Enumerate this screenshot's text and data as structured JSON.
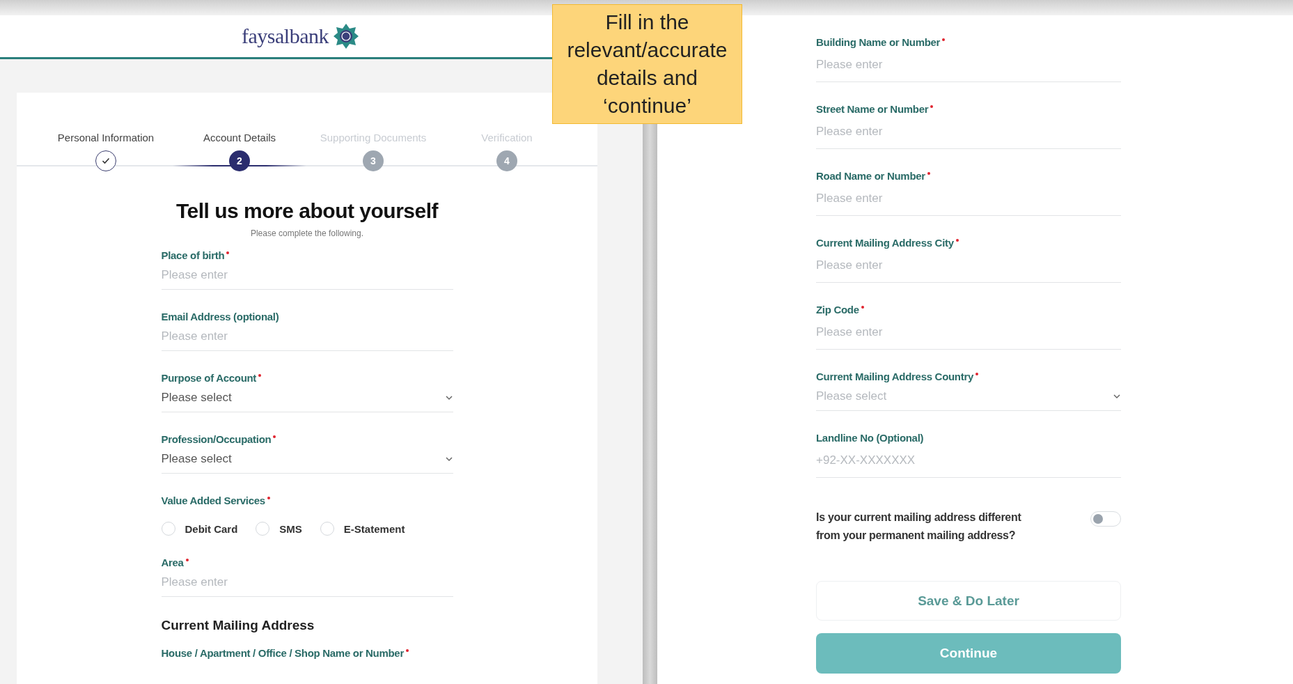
{
  "callout": {
    "text": "Fill in the relevant/accurate details and ‘continue’"
  },
  "left": {
    "logo": {
      "wordmark": "faysalbank"
    },
    "steps": [
      {
        "label": "Personal Information",
        "completed": true,
        "selected": false
      },
      {
        "label": "Account Details",
        "completed": false,
        "selected": true,
        "number": "2"
      },
      {
        "label": "Supporting Documents",
        "completed": false,
        "selected": false,
        "number": "3"
      },
      {
        "label": "Verification",
        "completed": false,
        "selected": false,
        "number": "4"
      }
    ],
    "title": "Tell us more about yourself",
    "subtitle": "Please complete the following.",
    "items": [
      {
        "kind": "text",
        "label": "Place of birth",
        "required": true,
        "placeholder": "Please enter"
      },
      {
        "kind": "text",
        "label": "Email Address (optional)",
        "required": false,
        "placeholder": "Please enter"
      },
      {
        "kind": "select",
        "label": "Purpose of Account",
        "required": true,
        "placeholder": "Please select"
      },
      {
        "kind": "select",
        "label": "Profession/Occupation",
        "required": true,
        "placeholder": "Please select"
      },
      {
        "kind": "radios",
        "label": "Value Added Services",
        "required": true,
        "options": [
          {
            "label": "Debit Card",
            "selected": false
          },
          {
            "label": "SMS",
            "selected": false
          },
          {
            "label": "E-Statement",
            "selected": false
          }
        ]
      },
      {
        "kind": "text",
        "label": "Area",
        "required": true,
        "placeholder": "Please enter"
      },
      {
        "kind": "heading",
        "label": "Current Mailing Address"
      },
      {
        "kind": "label",
        "label": "House / Apartment / Office / Shop Name or Number",
        "required": true
      }
    ]
  },
  "right": {
    "fields": [
      {
        "kind": "text",
        "label": "Building Name or Number",
        "required": true,
        "placeholder": "Please enter"
      },
      {
        "kind": "text",
        "label": "Street Name or Number",
        "required": true,
        "placeholder": "Please enter"
      },
      {
        "kind": "text",
        "label": "Road Name or Number",
        "required": true,
        "placeholder": "Please enter"
      },
      {
        "kind": "text",
        "label": "Current Mailing Address City",
        "required": true,
        "placeholder": "Please enter"
      },
      {
        "kind": "text",
        "label": "Zip Code",
        "required": true,
        "placeholder": "Please enter"
      },
      {
        "kind": "select",
        "label": "Current Mailing Address Country",
        "required": true,
        "placeholder": "Please select"
      },
      {
        "kind": "text",
        "label": "Landline No (Optional)",
        "required": false,
        "placeholder": "+92-XX-XXXXXXX"
      }
    ],
    "toggle": {
      "question": "Is your current mailing address different from your permanent mailing address?",
      "on": false
    },
    "buttons": {
      "secondary": "Save & Do Later",
      "primary": "Continue"
    }
  }
}
